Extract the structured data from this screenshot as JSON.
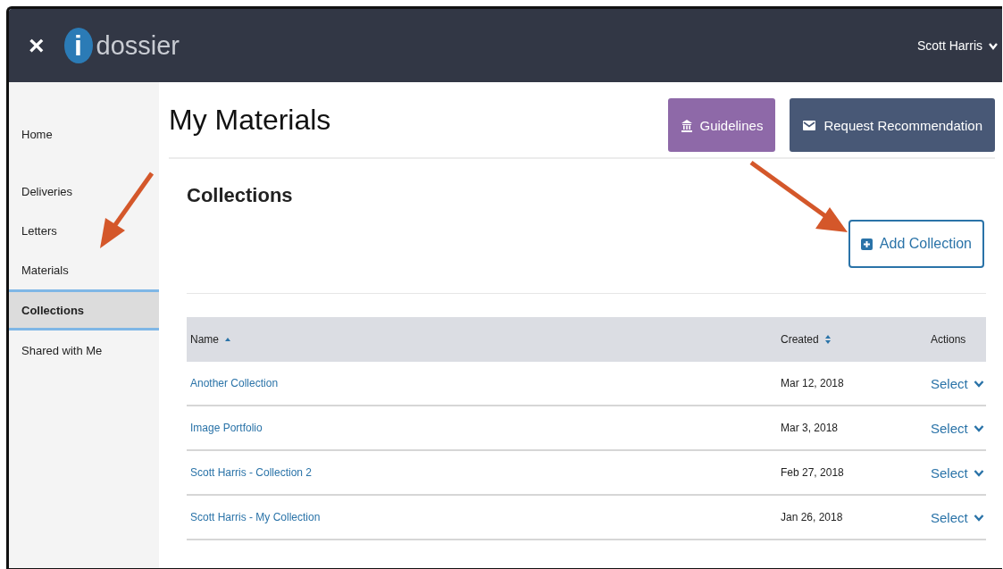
{
  "header": {
    "close": "×",
    "logo_letter": "i",
    "logo_text": "dossier",
    "user": "Scott Harris"
  },
  "sidebar": {
    "items": [
      {
        "label": "Home",
        "selected": false
      },
      {
        "label": "Deliveries",
        "selected": false
      },
      {
        "label": "Letters",
        "selected": false
      },
      {
        "label": "Materials",
        "selected": false
      },
      {
        "label": "Collections",
        "selected": true
      },
      {
        "label": "Shared with Me",
        "selected": false
      }
    ]
  },
  "page_title": "My Materials",
  "buttons": [
    {
      "kind": "guidelines",
      "label": "Guidelines"
    },
    {
      "kind": "request",
      "label": "Request Recommendation"
    }
  ],
  "section_title": "Collections",
  "add_button": "Add Collection",
  "table": {
    "columns": [
      {
        "label": "Name",
        "sortable": true,
        "sorted": true
      },
      {
        "label": "Created",
        "sortable": true,
        "sorted": false
      },
      {
        "label": "Actions",
        "sortable": false
      }
    ],
    "rows": [
      {
        "name": "Another Collection",
        "created": "Mar 12, 2018",
        "action": "Select"
      },
      {
        "name": "Image Portfolio",
        "created": "Mar 3, 2018",
        "action": "Select"
      },
      {
        "name": "Scott Harris - Collection 2",
        "created": "Feb 27, 2018",
        "action": "Select"
      },
      {
        "name": "Scott Harris - My Collection",
        "created": "Jan 26, 2018",
        "action": "Select"
      }
    ]
  },
  "annotation_arrows": [
    {
      "kind": "arrow"
    },
    {
      "kind": "arrow"
    }
  ]
}
